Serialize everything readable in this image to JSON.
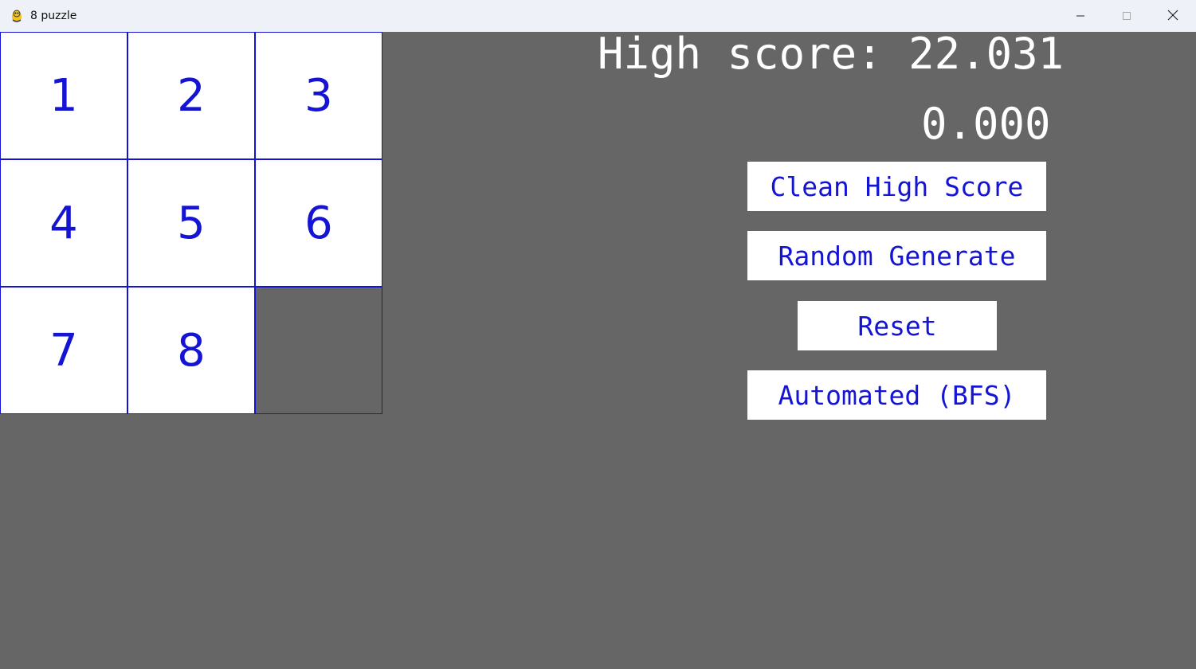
{
  "window": {
    "title": "8 puzzle",
    "app_icon": "pygame-snake-icon",
    "controls": [
      "minimize-icon",
      "maximize-icon",
      "close-icon"
    ]
  },
  "board": {
    "tiles": [
      "1",
      "2",
      "3",
      "4",
      "5",
      "6",
      "7",
      "8",
      ""
    ],
    "tile_color": "#1414d2",
    "background": "#666666"
  },
  "scores": {
    "high_score_label": "High score: 22.031",
    "timer": "0.000"
  },
  "buttons": {
    "clean_high_score": "Clean High Score",
    "random_generate": "Random Generate",
    "reset": "Reset",
    "automated_bfs": "Automated (BFS)"
  }
}
